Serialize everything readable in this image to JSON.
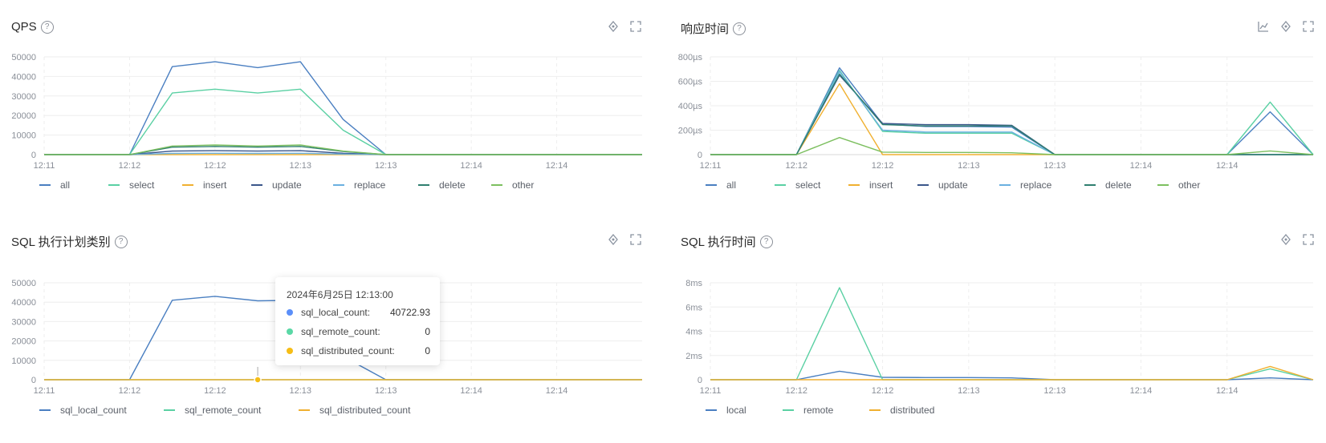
{
  "panels": [
    {
      "title": "QPS",
      "help": "?",
      "tools": [
        "share-icon",
        "expand-icon"
      ]
    },
    {
      "title": "响应时间",
      "help": "?",
      "tools": [
        "sql-chart-icon",
        "share-icon",
        "expand-icon"
      ]
    },
    {
      "title": "SQL 执行计划类别",
      "help": "?",
      "tools": [
        "share-icon",
        "expand-icon"
      ]
    },
    {
      "title": "SQL 执行时间",
      "help": "?",
      "tools": [
        "share-icon",
        "expand-icon"
      ]
    }
  ],
  "tooltip": {
    "title": "2024年6月25日 12:13:00",
    "rows": [
      {
        "name": "sql_local_count:",
        "value": "40722.93",
        "color": "#5b8ff9"
      },
      {
        "name": "sql_remote_count:",
        "value": "0",
        "color": "#5ad8a6"
      },
      {
        "name": "sql_distributed_count:",
        "value": "0",
        "color": "#f6bd16"
      }
    ]
  },
  "chart_data": [
    {
      "type": "line",
      "title": "QPS",
      "x_tick_labels": [
        "12:11",
        "12:12",
        "12:12",
        "12:13",
        "12:13",
        "12:14",
        "12:14"
      ],
      "y_ticks": [
        0,
        10000,
        20000,
        30000,
        40000,
        50000
      ],
      "y_tick_labels": [
        "0",
        "10000",
        "20000",
        "30000",
        "40000",
        "50000"
      ],
      "ylim": [
        0,
        50000
      ],
      "n_points": 15,
      "legend": "bottom",
      "series": [
        {
          "name": "all",
          "color": "#4a7fc1",
          "values": [
            0,
            0,
            0,
            45000,
            47500,
            44500,
            47500,
            18000,
            0,
            0,
            0,
            0,
            0,
            0,
            0
          ]
        },
        {
          "name": "select",
          "color": "#5ad0a3",
          "values": [
            0,
            0,
            0,
            31500,
            33500,
            31500,
            33500,
            12500,
            0,
            0,
            0,
            0,
            0,
            0,
            0
          ]
        },
        {
          "name": "insert",
          "color": "#f0b030",
          "values": [
            0,
            0,
            0,
            0,
            0,
            0,
            0,
            0,
            0,
            0,
            0,
            0,
            0,
            0,
            0
          ]
        },
        {
          "name": "update",
          "color": "#3a568a",
          "values": [
            0,
            0,
            0,
            1800,
            2000,
            1800,
            2000,
            700,
            0,
            0,
            0,
            0,
            0,
            0,
            0
          ]
        },
        {
          "name": "replace",
          "color": "#6ab0e0",
          "values": [
            0,
            0,
            0,
            600,
            700,
            600,
            700,
            250,
            0,
            0,
            0,
            0,
            0,
            0,
            0
          ]
        },
        {
          "name": "delete",
          "color": "#2f7f6f",
          "values": [
            0,
            0,
            0,
            3800,
            4200,
            3800,
            4200,
            1600,
            0,
            0,
            0,
            0,
            0,
            0,
            0
          ]
        },
        {
          "name": "other",
          "color": "#7cbf5f",
          "values": [
            0,
            0,
            0,
            4400,
            4900,
            4400,
            4900,
            1800,
            0,
            0,
            0,
            0,
            0,
            0,
            0
          ]
        }
      ]
    },
    {
      "type": "line",
      "title": "响应时间",
      "x_tick_labels": [
        "12:11",
        "12:12",
        "12:12",
        "12:13",
        "12:13",
        "12:14",
        "12:14"
      ],
      "y_ticks": [
        0,
        200,
        400,
        600,
        800
      ],
      "y_tick_labels": [
        "0",
        "200µs",
        "400µs",
        "600µs",
        "800µs"
      ],
      "ylim": [
        0,
        800
      ],
      "n_points": 15,
      "legend": "bottom",
      "series": [
        {
          "name": "all",
          "color": "#4a7fc1",
          "values": [
            0,
            0,
            0,
            710,
            250,
            230,
            230,
            225,
            0,
            0,
            0,
            0,
            0,
            350,
            0
          ]
        },
        {
          "name": "select",
          "color": "#5ad0a3",
          "values": [
            0,
            0,
            0,
            690,
            190,
            175,
            175,
            175,
            0,
            0,
            0,
            0,
            0,
            430,
            0
          ]
        },
        {
          "name": "insert",
          "color": "#f0b030",
          "values": [
            0,
            0,
            0,
            580,
            0,
            0,
            0,
            0,
            0,
            0,
            0,
            0,
            0,
            0,
            0
          ]
        },
        {
          "name": "update",
          "color": "#3a568a",
          "values": [
            0,
            0,
            0,
            650,
            255,
            245,
            245,
            240,
            0,
            0,
            0,
            0,
            0,
            0,
            0
          ]
        },
        {
          "name": "replace",
          "color": "#6ab0e0",
          "values": [
            0,
            0,
            0,
            680,
            200,
            185,
            185,
            185,
            0,
            0,
            0,
            0,
            0,
            0,
            0
          ]
        },
        {
          "name": "delete",
          "color": "#2f7f6f",
          "values": [
            0,
            0,
            0,
            660,
            245,
            235,
            235,
            235,
            0,
            0,
            0,
            0,
            0,
            0,
            0
          ]
        },
        {
          "name": "other",
          "color": "#7cbf5f",
          "values": [
            0,
            0,
            0,
            140,
            20,
            18,
            18,
            15,
            0,
            0,
            0,
            0,
            0,
            30,
            0
          ]
        }
      ]
    },
    {
      "type": "line",
      "title": "SQL 执行计划类别",
      "x_tick_labels": [
        "12:11",
        "12:12",
        "12:12",
        "12:13",
        "12:13",
        "12:14",
        "12:14"
      ],
      "y_ticks": [
        0,
        10000,
        20000,
        30000,
        40000,
        50000
      ],
      "y_tick_labels": [
        "0",
        "10000",
        "20000",
        "30000",
        "40000",
        "50000"
      ],
      "ylim": [
        0,
        50000
      ],
      "n_points": 15,
      "legend": "bottom",
      "series": [
        {
          "name": "sql_local_count",
          "color": "#4a7fc1",
          "values": [
            0,
            0,
            0,
            41000,
            43000,
            40722.93,
            41000,
            12000,
            0,
            0,
            0,
            0,
            0,
            0,
            0
          ]
        },
        {
          "name": "sql_remote_count",
          "color": "#5ad0a3",
          "values": [
            0,
            0,
            0,
            0,
            0,
            0,
            0,
            0,
            0,
            0,
            0,
            0,
            0,
            0,
            0
          ]
        },
        {
          "name": "sql_distributed_count",
          "color": "#f0b030",
          "values": [
            0,
            0,
            0,
            0,
            0,
            0,
            0,
            0,
            0,
            0,
            0,
            0,
            0,
            0,
            0
          ]
        }
      ]
    },
    {
      "type": "line",
      "title": "SQL 执行时间",
      "x_tick_labels": [
        "12:11",
        "12:12",
        "12:12",
        "12:13",
        "12:13",
        "12:14",
        "12:14"
      ],
      "y_ticks": [
        0,
        2,
        4,
        6,
        8
      ],
      "y_tick_labels": [
        "0",
        "2ms",
        "4ms",
        "6ms",
        "8ms"
      ],
      "ylim": [
        0,
        8
      ],
      "n_points": 15,
      "legend": "bottom",
      "series": [
        {
          "name": "local",
          "color": "#4a7fc1",
          "values": [
            0,
            0,
            0,
            0.7,
            0.2,
            0.18,
            0.18,
            0.15,
            0,
            0,
            0,
            0,
            0,
            0.15,
            0
          ]
        },
        {
          "name": "remote",
          "color": "#5ad0a3",
          "values": [
            0,
            0,
            0,
            7.6,
            0,
            0,
            0,
            0,
            0,
            0,
            0,
            0,
            0,
            0.9,
            0
          ]
        },
        {
          "name": "distributed",
          "color": "#f0b030",
          "values": [
            0,
            0,
            0,
            0,
            0,
            0,
            0,
            0,
            0,
            0,
            0,
            0,
            0,
            1.1,
            0
          ]
        }
      ]
    }
  ]
}
